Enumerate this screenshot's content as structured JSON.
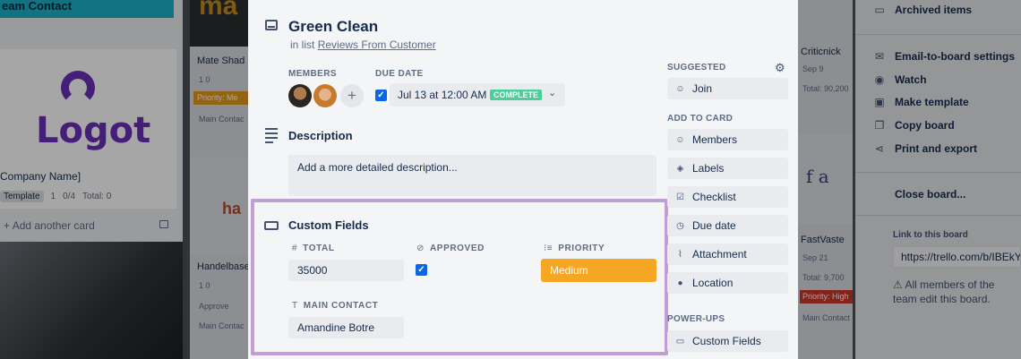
{
  "background": {
    "team_contact": "eam Contact",
    "logo_text": "Logot",
    "company_name": "Company Name]",
    "template_badge": "Template",
    "attach_count": "1",
    "checklist": "0/4",
    "total": "Total: 0",
    "add_card": "Add another card",
    "col2_card1_title": "Mate Shad",
    "col2_card1_badges": "1 0",
    "col2_priority": "Priority: Me",
    "col2_main_contact": "Main Contac",
    "col2_ha": "ha",
    "col2_card2_title": "Handelbase",
    "col2_card2_badges": "1 0",
    "col2_approved": "Approve",
    "col2_main_contact2": "Main Contac",
    "col3_card1_title": "Criticnick",
    "col3_card1_date": "Sep 9",
    "col3_card1_total": "Total: 90,200",
    "col3_fa": "f a",
    "col3_card2_title": "FastVaste",
    "col3_card2_date": "Sep 21",
    "col3_card2_total": "Total: 9,700",
    "col3_priority": "Priority: High",
    "col3_main_contact": "Main Contact"
  },
  "menu": {
    "archived": "Archived items",
    "email": "Email-to-board settings",
    "watch": "Watch",
    "make_template": "Make template",
    "copy_board": "Copy board",
    "print_export": "Print and export",
    "close_board": "Close board...",
    "link_label": "Link to this board",
    "link_value": "https://trello.com/b/IBEkY",
    "note": "All members of the team edit this board."
  },
  "card": {
    "title": "Green Clean",
    "in_list_prefix": "in list",
    "list_name": "Reviews From Customer",
    "members_label": "MEMBERS",
    "due_label": "DUE DATE",
    "due_value": "Jul 13 at 12:00 AM",
    "due_status": "COMPLETE",
    "description_title": "Description",
    "description_placeholder": "Add a more detailed description...",
    "custom_fields_title": "Custom Fields",
    "fields": {
      "total_label": "TOTAL",
      "total_value": "35000",
      "approved_label": "APPROVED",
      "priority_label": "PRIORITY",
      "priority_value": "Medium",
      "contact_label": "MAIN CONTACT",
      "contact_value": "Amandine Botre"
    }
  },
  "sidebar": {
    "suggested": "SUGGESTED",
    "join": "Join",
    "add_to_card": "ADD TO CARD",
    "members": "Members",
    "labels": "Labels",
    "checklist": "Checklist",
    "due_date": "Due date",
    "attachment": "Attachment",
    "location": "Location",
    "power_ups": "POWER-UPS",
    "custom_fields": "Custom Fields"
  },
  "colors": {
    "priority_medium": "#f5a623",
    "complete_badge": "#4bce97",
    "highlight_frame": "#c19ed3",
    "logo_purple": "#6b2fb8"
  }
}
